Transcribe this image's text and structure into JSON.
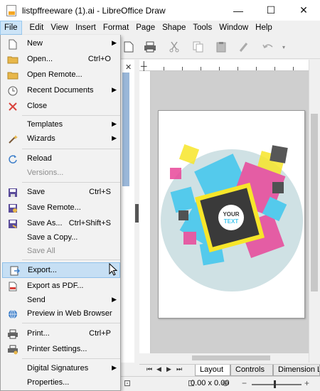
{
  "window": {
    "title": "listpffreeware (1).ai - LibreOffice Draw",
    "minimize": "—",
    "maximize": "☐",
    "close": "✕"
  },
  "menubar": [
    {
      "label": "File",
      "name": "menu-file",
      "active": true
    },
    {
      "label": "Edit",
      "name": "menu-edit"
    },
    {
      "label": "View",
      "name": "menu-view"
    },
    {
      "label": "Insert",
      "name": "menu-insert"
    },
    {
      "label": "Format",
      "name": "menu-format"
    },
    {
      "label": "Page",
      "name": "menu-page"
    },
    {
      "label": "Shape",
      "name": "menu-shape"
    },
    {
      "label": "Tools",
      "name": "menu-tools"
    },
    {
      "label": "Window",
      "name": "menu-window"
    },
    {
      "label": "Help",
      "name": "menu-help"
    }
  ],
  "file_menu": {
    "new": {
      "label": "New",
      "icon": "new-document-icon"
    },
    "open": {
      "label": "Open...",
      "shortcut": "Ctrl+O",
      "icon": "folder-open-icon"
    },
    "open_remote": {
      "label": "Open Remote...",
      "icon": "folder-remote-icon"
    },
    "recent": {
      "label": "Recent Documents",
      "icon": "clock-icon"
    },
    "close": {
      "label": "Close",
      "icon": "close-red-x-icon"
    },
    "templates": {
      "label": "Templates"
    },
    "wizards": {
      "label": "Wizards",
      "icon": "wand-icon"
    },
    "reload": {
      "label": "Reload",
      "icon": "reload-icon"
    },
    "versions": {
      "label": "Versions..."
    },
    "save": {
      "label": "Save",
      "shortcut": "Ctrl+S",
      "icon": "floppy-save-icon"
    },
    "save_remote": {
      "label": "Save Remote...",
      "icon": "floppy-remote-icon"
    },
    "save_as": {
      "label": "Save As...",
      "shortcut": "Ctrl+Shift+S",
      "icon": "floppy-save-as-icon"
    },
    "save_copy": {
      "label": "Save a Copy..."
    },
    "save_all": {
      "label": "Save All"
    },
    "export": {
      "label": "Export...",
      "icon": "export-icon"
    },
    "export_pdf": {
      "label": "Export as PDF...",
      "icon": "pdf-icon"
    },
    "send": {
      "label": "Send"
    },
    "preview_web": {
      "label": "Preview in Web Browser",
      "icon": "globe-icon"
    },
    "print": {
      "label": "Print...",
      "shortcut": "Ctrl+P",
      "icon": "printer-icon"
    },
    "printer_settings": {
      "label": "Printer Settings...",
      "icon": "printer-settings-icon"
    },
    "digital_signatures": {
      "label": "Digital Signatures"
    },
    "properties": {
      "label": "Properties..."
    }
  },
  "artwork": {
    "badge_line1": "YOUR",
    "badge_line2": "TEXT",
    "colors": {
      "cyan": "#3fc6ee",
      "magenta": "#e8479a",
      "yellow": "#f7e62a",
      "dark": "#3a3a3a",
      "circle": "#cfe1e4"
    }
  },
  "tabs": {
    "layout": "Layout",
    "controls": "Controls",
    "dimension": "Dimension Lines"
  },
  "status": {
    "dims": "0.00 x 0.00"
  },
  "accent": {
    "highlight": "#c6dff4",
    "highlight_border": "#8ec0ea"
  }
}
